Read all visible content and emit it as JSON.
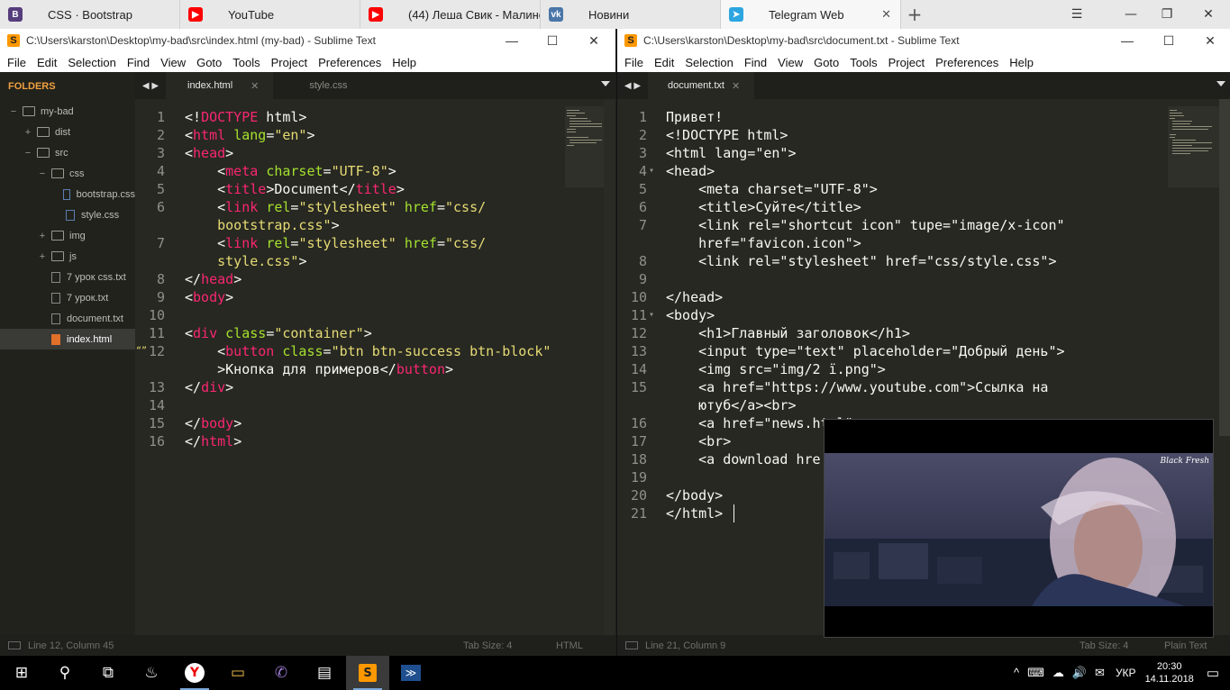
{
  "browser": {
    "tabs": [
      {
        "label": "CSS · Bootstrap",
        "favicon": "bootstrap-icon",
        "color": "#563d7c",
        "glyph": "B"
      },
      {
        "label": "YouTube",
        "favicon": "youtube-icon",
        "color": "#ff0000",
        "glyph": "▶"
      },
      {
        "label": "(44) Леша Свик - Малинов",
        "favicon": "youtube-icon",
        "color": "#ff0000",
        "glyph": "▶"
      },
      {
        "label": "Новини",
        "favicon": "vk-icon",
        "color": "#4a76a8",
        "glyph": "vk"
      },
      {
        "label": "Telegram Web",
        "favicon": "telegram-icon",
        "color": "#2ca5e0",
        "glyph": "➤"
      }
    ],
    "tab_close": "✕",
    "new_tab": "+",
    "menu_icon": "☰",
    "win_min": "—",
    "win_max": "❐",
    "win_close": "✕"
  },
  "left_window": {
    "title": "C:\\Users\\karston\\Desktop\\my-bad\\src\\index.html (my-bad) - Sublime Text",
    "menu": [
      "File",
      "Edit",
      "Selection",
      "Find",
      "View",
      "Goto",
      "Tools",
      "Project",
      "Preferences",
      "Help"
    ],
    "sidebar_header": "FOLDERS",
    "tree": [
      {
        "label": "my-bad",
        "tw": "−",
        "kind": "folder"
      },
      {
        "label": "dist",
        "tw": "+",
        "kind": "folder"
      },
      {
        "label": "src",
        "tw": "−",
        "kind": "folder"
      },
      {
        "label": "css",
        "tw": "−",
        "kind": "folder"
      },
      {
        "label": "bootstrap.css",
        "tw": "",
        "kind": "css"
      },
      {
        "label": "style.css",
        "tw": "",
        "kind": "css"
      },
      {
        "label": "img",
        "tw": "+",
        "kind": "folder"
      },
      {
        "label": "js",
        "tw": "+",
        "kind": "folder"
      },
      {
        "label": "7 урок css.txt",
        "tw": "",
        "kind": "file"
      },
      {
        "label": "7 урок.txt",
        "tw": "",
        "kind": "file"
      },
      {
        "label": "document.txt",
        "tw": "",
        "kind": "file"
      },
      {
        "label": "index.html",
        "tw": "",
        "kind": "html"
      }
    ],
    "tabs": [
      {
        "label": "index.html",
        "close": "✕"
      },
      {
        "label": "style.css",
        "close": ""
      }
    ],
    "nav": "◀ ▶",
    "lines": [
      {
        "n": "1",
        "segs": [
          [
            "p",
            "<!"
          ],
          [
            "t",
            "DOCTYPE"
          ],
          [
            "p",
            " html>"
          ]
        ]
      },
      {
        "n": "2",
        "segs": [
          [
            "p",
            "<"
          ],
          [
            "t",
            "html"
          ],
          [
            "p",
            " "
          ],
          [
            "a",
            "lang"
          ],
          [
            "p",
            "="
          ],
          [
            "s",
            "\"en\""
          ],
          [
            "p",
            ">"
          ]
        ]
      },
      {
        "n": "3",
        "segs": [
          [
            "p",
            "<"
          ],
          [
            "t",
            "head"
          ],
          [
            "p",
            ">"
          ]
        ]
      },
      {
        "n": "4",
        "segs": [
          [
            "p",
            "    <"
          ],
          [
            "t",
            "meta"
          ],
          [
            "p",
            " "
          ],
          [
            "a",
            "charset"
          ],
          [
            "p",
            "="
          ],
          [
            "s",
            "\"UTF-8\""
          ],
          [
            "p",
            ">"
          ]
        ]
      },
      {
        "n": "5",
        "segs": [
          [
            "p",
            "    <"
          ],
          [
            "t",
            "title"
          ],
          [
            "p",
            ">Document</"
          ],
          [
            "t",
            "title"
          ],
          [
            "p",
            ">"
          ]
        ]
      },
      {
        "n": "6",
        "segs": [
          [
            "p",
            "    <"
          ],
          [
            "t",
            "link"
          ],
          [
            "p",
            " "
          ],
          [
            "a",
            "rel"
          ],
          [
            "p",
            "="
          ],
          [
            "s",
            "\"stylesheet\""
          ],
          [
            "p",
            " "
          ],
          [
            "a",
            "href"
          ],
          [
            "p",
            "="
          ],
          [
            "s",
            "\"css/"
          ]
        ]
      },
      {
        "n": "",
        "segs": [
          [
            "s",
            "    bootstrap.css\""
          ],
          [
            "p",
            ">"
          ]
        ]
      },
      {
        "n": "7",
        "segs": [
          [
            "p",
            "    <"
          ],
          [
            "t",
            "link"
          ],
          [
            "p",
            " "
          ],
          [
            "a",
            "rel"
          ],
          [
            "p",
            "="
          ],
          [
            "s",
            "\"stylesheet\""
          ],
          [
            "p",
            " "
          ],
          [
            "a",
            "href"
          ],
          [
            "p",
            "="
          ],
          [
            "s",
            "\"css/"
          ]
        ]
      },
      {
        "n": "",
        "segs": [
          [
            "s",
            "    style.css\""
          ],
          [
            "p",
            ">"
          ]
        ]
      },
      {
        "n": "8",
        "segs": [
          [
            "p",
            "</"
          ],
          [
            "t",
            "head"
          ],
          [
            "p",
            ">"
          ]
        ]
      },
      {
        "n": "9",
        "segs": [
          [
            "p",
            "<"
          ],
          [
            "t",
            "body"
          ],
          [
            "p",
            ">"
          ]
        ]
      },
      {
        "n": "10",
        "segs": []
      },
      {
        "n": "11",
        "segs": [
          [
            "p",
            "<"
          ],
          [
            "t",
            "div"
          ],
          [
            "p",
            " "
          ],
          [
            "a",
            "class"
          ],
          [
            "p",
            "="
          ],
          [
            "s",
            "\"container\""
          ],
          [
            "p",
            ">"
          ]
        ]
      },
      {
        "n": "12",
        "segs": [
          [
            "p",
            "    <"
          ],
          [
            "t",
            "button"
          ],
          [
            "p",
            " "
          ],
          [
            "a",
            "class"
          ],
          [
            "p",
            "="
          ],
          [
            "s",
            "\"btn btn-success btn-block\""
          ]
        ]
      },
      {
        "n": "",
        "segs": [
          [
            "p",
            "    >Кнопка для примеров</"
          ],
          [
            "t",
            "button"
          ],
          [
            "p",
            ">"
          ]
        ]
      },
      {
        "n": "13",
        "segs": [
          [
            "p",
            "</"
          ],
          [
            "t",
            "div"
          ],
          [
            "p",
            ">"
          ]
        ]
      },
      {
        "n": "14",
        "segs": []
      },
      {
        "n": "15",
        "segs": [
          [
            "p",
            "</"
          ],
          [
            "t",
            "body"
          ],
          [
            "p",
            ">"
          ]
        ]
      },
      {
        "n": "16",
        "segs": [
          [
            "p",
            "</"
          ],
          [
            "t",
            "html"
          ],
          [
            "p",
            ">"
          ]
        ]
      }
    ],
    "gutter_mark": "“”",
    "status_left": "Line 12, Column 45",
    "status_tab": "Tab Size: 4",
    "status_syntax": "HTML"
  },
  "right_window": {
    "title": "C:\\Users\\karston\\Desktop\\my-bad\\src\\document.txt - Sublime Text",
    "menu": [
      "File",
      "Edit",
      "Selection",
      "Find",
      "View",
      "Goto",
      "Tools",
      "Project",
      "Preferences",
      "Help"
    ],
    "tabs": [
      {
        "label": "document.txt",
        "close": "✕"
      }
    ],
    "nav": "◀ ▶",
    "lines": [
      {
        "n": "1",
        "text": "Привет!"
      },
      {
        "n": "2",
        "text": "<!DOCTYPE html>"
      },
      {
        "n": "3",
        "text": "<html lang=\"en\">"
      },
      {
        "n": "4",
        "text": "<head>",
        "fold": "▾"
      },
      {
        "n": "5",
        "text": "    <meta charset=\"UTF-8\">"
      },
      {
        "n": "6",
        "text": "    <title>Суйте</title>"
      },
      {
        "n": "7",
        "text": "    <link rel=\"shortcut icon\" tupe=\"image/x-icon\""
      },
      {
        "n": "",
        "text": "    href=\"favicon.icon\">"
      },
      {
        "n": "8",
        "text": "    <link rel=\"stylesheet\" href=\"css/style.css\">"
      },
      {
        "n": "9",
        "text": ""
      },
      {
        "n": "10",
        "text": "</head>"
      },
      {
        "n": "11",
        "text": "<body>",
        "fold": "▾"
      },
      {
        "n": "12",
        "text": "    <h1>Главный заголовок</h1>"
      },
      {
        "n": "13",
        "text": "    <input type=\"text\" placeholder=\"Добрый день\">"
      },
      {
        "n": "14",
        "text": "    <img src=\"img/2 ї.png\">"
      },
      {
        "n": "15",
        "text": "    <a href=\"https://www.youtube.com\">Ссылка на"
      },
      {
        "n": "",
        "text": "    ютуб</a><br>"
      },
      {
        "n": "16",
        "text": "    <a href=\"news.html\">"
      },
      {
        "n": "17",
        "text": "    <br>"
      },
      {
        "n": "18",
        "text": "    <a download hre"
      },
      {
        "n": "19",
        "text": ""
      },
      {
        "n": "20",
        "text": "</body>"
      },
      {
        "n": "21",
        "text": "</html>"
      }
    ],
    "status_left": "Line 21, Column 9",
    "status_tab": "Tab Size: 4",
    "status_syntax": "Plain Text"
  },
  "video": {
    "watermark": "Black Fresh"
  },
  "taskbar": {
    "apps": [
      {
        "name": "start-button",
        "glyph": "⊞",
        "running": false
      },
      {
        "name": "search-icon",
        "glyph": "⚲",
        "running": false
      },
      {
        "name": "task-view-icon",
        "glyph": "⧉",
        "running": false
      },
      {
        "name": "steam-icon",
        "glyph": "♨",
        "running": false
      },
      {
        "name": "yandex-browser-icon",
        "glyph": "Y",
        "running": true
      },
      {
        "name": "file-explorer-icon",
        "glyph": "▭",
        "running": false
      },
      {
        "name": "viber-icon",
        "glyph": "✆",
        "running": false
      },
      {
        "name": "network-app-icon",
        "glyph": "▤",
        "running": false
      },
      {
        "name": "sublime-text-icon",
        "glyph": "S",
        "running": true
      },
      {
        "name": "powershell-icon",
        "glyph": "≫",
        "running": false
      }
    ],
    "lang": "УКР",
    "time": "20:30",
    "date": "14.11.2018",
    "tray_icons": [
      "^",
      "⌨",
      "☁",
      "🔊",
      "✉"
    ]
  }
}
